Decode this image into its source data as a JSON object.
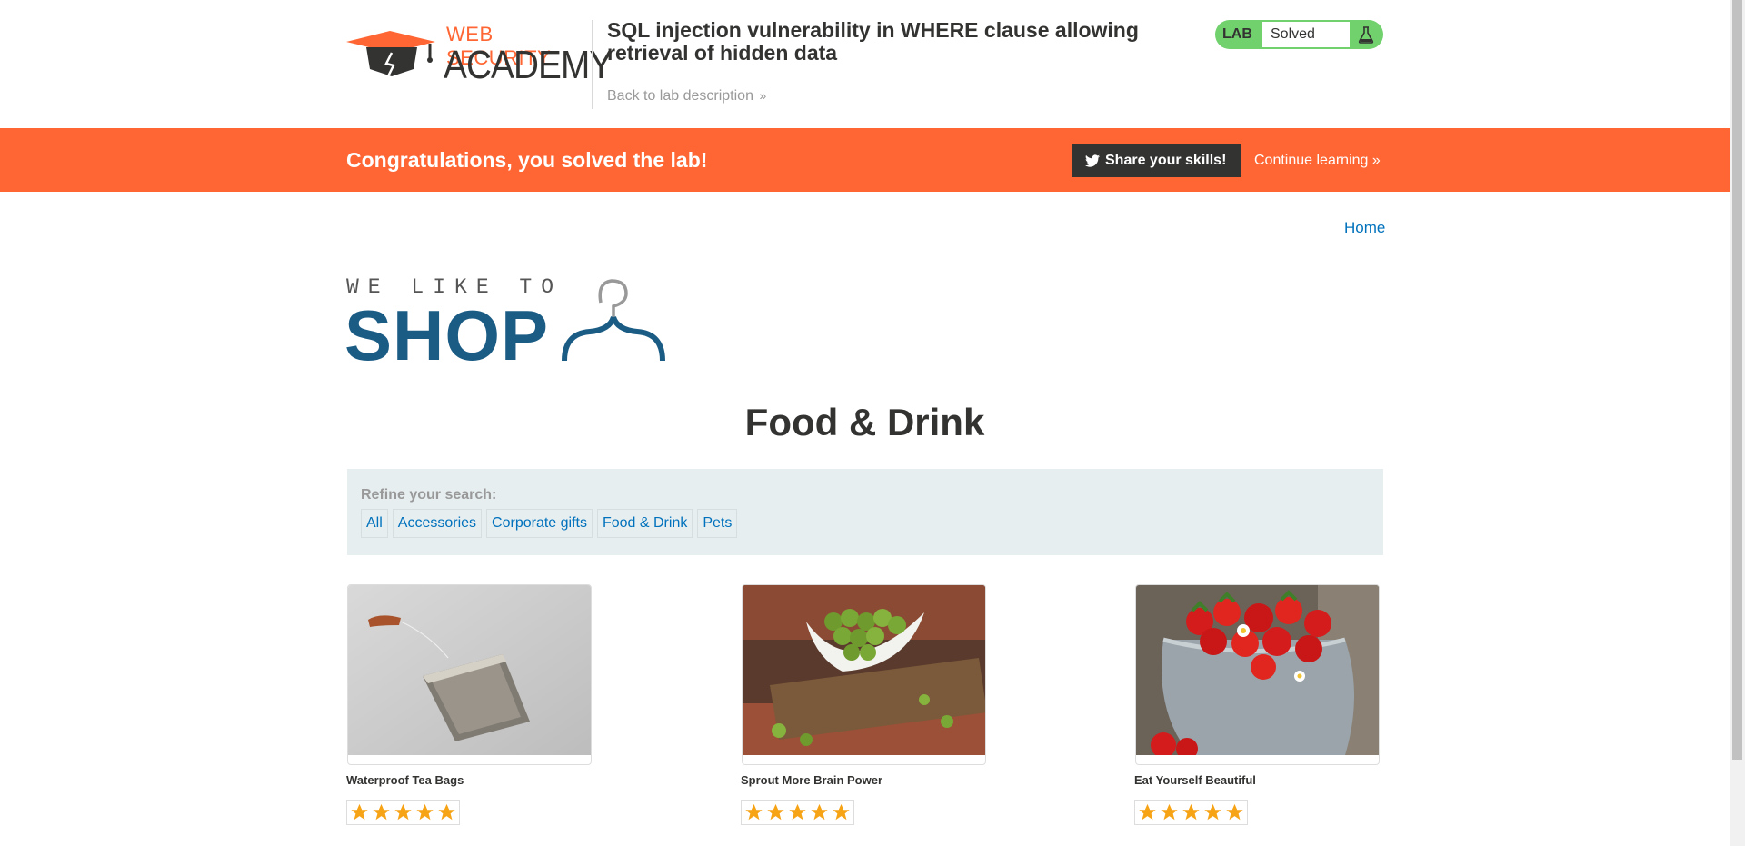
{
  "academy": {
    "brand_top": "WEB SECURITY",
    "brand_bottom": "ACADEMY",
    "lab_title": "SQL injection vulnerability in WHERE clause allowing retrieval of hidden data",
    "back_link": "Back to lab description",
    "lab_badge": "LAB",
    "lab_status": "Solved"
  },
  "banner": {
    "message": "Congratulations, you solved the lab!",
    "share_label": "Share your skills!",
    "continue_label": "Continue learning"
  },
  "shop": {
    "home_link": "Home",
    "logo_tagline": "WE LIKE TO",
    "logo_word": "SHOP",
    "page_title": "Food & Drink",
    "refine_label": "Refine your search:",
    "categories": [
      "All",
      "Accessories",
      "Corporate gifts",
      "Food & Drink",
      "Pets"
    ],
    "products": [
      {
        "name": "Waterproof Tea Bags",
        "rating": 5
      },
      {
        "name": "Sprout More Brain Power",
        "rating": 5
      },
      {
        "name": "Eat Yourself Beautiful",
        "rating": 5
      }
    ]
  },
  "colors": {
    "accent_orange": "#ff6633",
    "solved_green": "#70d16d",
    "link_blue": "#0071bc",
    "shop_blue": "#1b5c85",
    "star_orange": "#f6a316"
  }
}
